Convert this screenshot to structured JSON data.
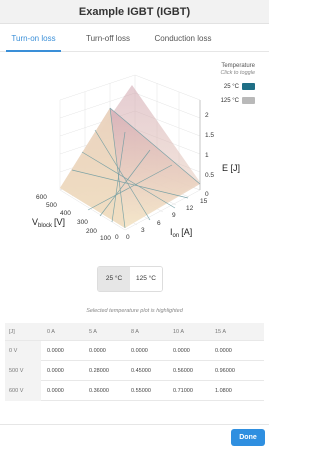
{
  "window": {
    "title": "Example IGBT (IGBT)"
  },
  "tabs": [
    {
      "label": "Turn-on loss",
      "active": true
    },
    {
      "label": "Turn-off loss",
      "active": false
    },
    {
      "label": "Conduction loss",
      "active": false
    }
  ],
  "legend": {
    "title": "Temperature",
    "subtitle": "Click to toggle",
    "items": [
      {
        "label": "25 °C",
        "color": "#1f6f86"
      },
      {
        "label": "125 °C",
        "color": "#b9b9b9"
      }
    ]
  },
  "plot": {
    "x_axis": {
      "label_main": "V",
      "label_sub": "block",
      "label_unit": "[V]",
      "ticks": [
        "600",
        "500",
        "400",
        "300",
        "200",
        "100",
        "0"
      ]
    },
    "y_axis": {
      "label_main": "I",
      "label_sub": "on",
      "label_unit": "[A]",
      "ticks": [
        "0",
        "3",
        "6",
        "9",
        "12",
        "15"
      ]
    },
    "z_axis": {
      "label": "E [J]",
      "ticks": [
        "0",
        "0.5",
        "1",
        "1.5",
        "2"
      ]
    }
  },
  "temp_toggle": {
    "options": [
      "25 °C",
      "125 °C"
    ],
    "selected": "25 °C"
  },
  "hint": "Selected temperature plot is highlighted",
  "table": {
    "corner": "[J]",
    "columns": [
      "0 A",
      "5 A",
      "8 A",
      "10 A",
      "15 A"
    ],
    "rows": [
      {
        "label": "0 V",
        "values": [
          "0.0000",
          "0.0000",
          "0.0000",
          "0.0000",
          "0.0000"
        ]
      },
      {
        "label": "500 V",
        "values": [
          "0.0000",
          "0.28000",
          "0.45000",
          "0.56000",
          "0.96000"
        ]
      },
      {
        "label": "600 V",
        "values": [
          "0.0000",
          "0.36000",
          "0.55000",
          "0.71000",
          "1.0800"
        ]
      }
    ]
  },
  "footer": {
    "done_label": "Done"
  }
}
